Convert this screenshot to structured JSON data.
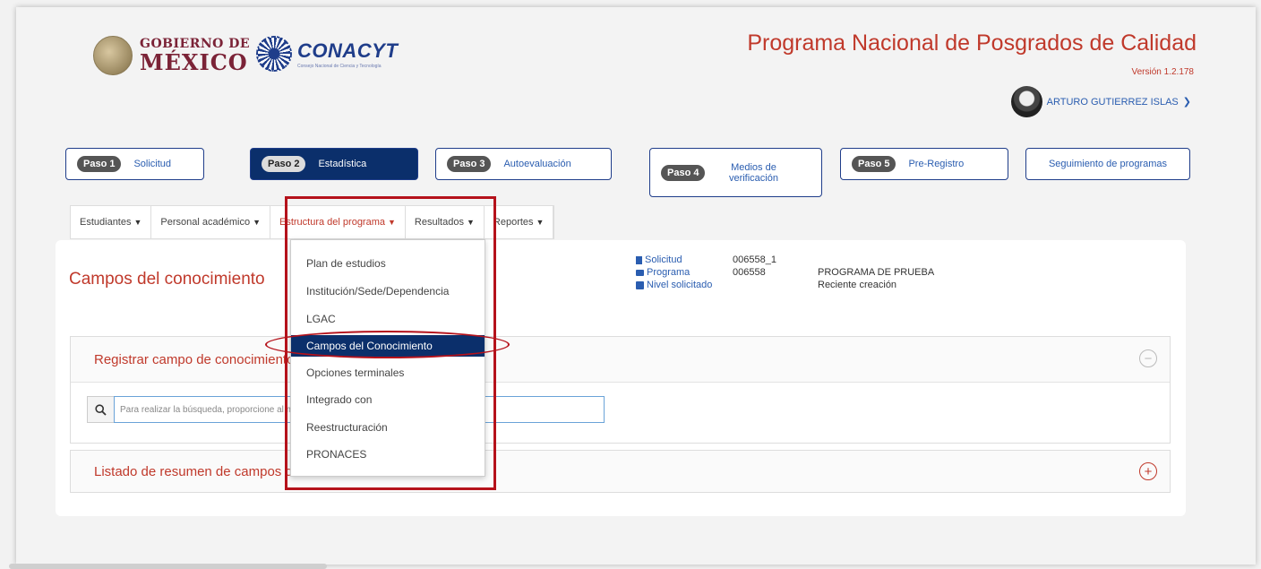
{
  "header": {
    "gobierno_line1": "GOBIERNO DE",
    "gobierno_line2": "MÉXICO",
    "conacyt_name": "CONACYT",
    "conacyt_subtitle": "Consejo Nacional de Ciencia y Tecnología",
    "app_title": "Programa Nacional de Posgrados de Calidad",
    "version": "Versión 1.2.178",
    "user_name": "ARTURO GUTIERREZ ISLAS"
  },
  "steps": [
    {
      "pill": "Paso 1",
      "label": "Solicitud"
    },
    {
      "pill": "Paso 2",
      "label": "Estadística"
    },
    {
      "pill": "Paso 3",
      "label": "Autoevaluación"
    },
    {
      "pill": "Paso 4",
      "label": "Medios de verificación"
    },
    {
      "pill": "Paso 5",
      "label": "Pre-Registro"
    },
    {
      "pill": "",
      "label": "Seguimiento de programas"
    }
  ],
  "tabs": [
    {
      "label": "Estudiantes"
    },
    {
      "label": "Personal académico"
    },
    {
      "label": "Estructura del programa"
    },
    {
      "label": "Resultados"
    },
    {
      "label": "Reportes"
    }
  ],
  "main": {
    "page_title": "Campos del conocimiento",
    "info": {
      "solicitud_label": "Solicitud",
      "solicitud_value": "006558_1",
      "programa_label": "Programa",
      "programa_value": "006558",
      "programa_desc": "PROGRAMA DE PRUEBA",
      "nivel_label": "Nivel solicitado",
      "nivel_desc": "Reciente creación"
    },
    "section_register_title": "Registrar campo de conocimiento",
    "search_placeholder": "Para realizar la búsqueda, proporcione al menos tres caracteres.",
    "section_list_title": "Listado de resumen de campos del conocimiento"
  },
  "dropdown": {
    "items": [
      "Plan de estudios",
      "Institución/Sede/Dependencia",
      "LGAC",
      "Campos del Conocimiento",
      "Opciones terminales",
      "Integrado con",
      "Reestructuración",
      "PRONACES"
    ],
    "selected": "Campos del Conocimiento"
  },
  "colors": {
    "brand_red": "#c0392b",
    "navy": "#0b2f6b",
    "link_blue": "#2a5db0",
    "highlight_red": "#b5121b"
  }
}
